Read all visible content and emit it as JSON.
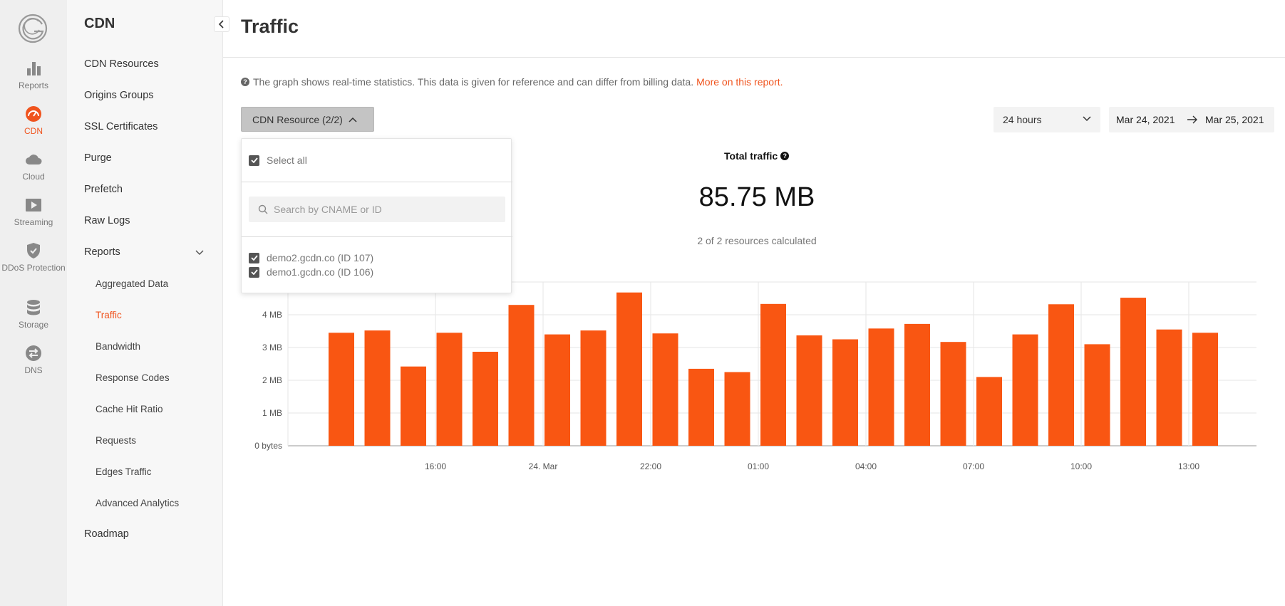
{
  "rail": {
    "items": [
      {
        "label": "Reports",
        "icon": "bar-chart-icon"
      },
      {
        "label": "CDN",
        "icon": "speedometer-icon",
        "active": true
      },
      {
        "label": "Cloud",
        "icon": "cloud-icon"
      },
      {
        "label": "Streaming",
        "icon": "play-icon"
      },
      {
        "label": "DDoS Protection",
        "icon": "shield-check-icon"
      },
      {
        "label": "Storage",
        "icon": "database-icon"
      },
      {
        "label": "DNS",
        "icon": "swap-icon"
      }
    ]
  },
  "nav": {
    "title": "CDN",
    "items": [
      {
        "label": "CDN Resources"
      },
      {
        "label": "Origins Groups"
      },
      {
        "label": "SSL Certificates"
      },
      {
        "label": "Purge"
      },
      {
        "label": "Prefetch"
      },
      {
        "label": "Raw Logs"
      },
      {
        "label": "Reports"
      }
    ],
    "reports_sub": [
      {
        "label": "Aggregated Data"
      },
      {
        "label": "Traffic",
        "active": true
      },
      {
        "label": "Bandwidth"
      },
      {
        "label": "Response Codes"
      },
      {
        "label": "Cache Hit Ratio"
      },
      {
        "label": "Requests"
      },
      {
        "label": "Edges Traffic"
      },
      {
        "label": "Advanced Analytics"
      }
    ],
    "roadmap": "Roadmap"
  },
  "main": {
    "title": "Traffic",
    "info_text": "The graph shows real-time statistics. This data is given for reference and can differ from billing data.",
    "info_link": "More on this report.",
    "resource_button": "CDN Resource (2/2)",
    "period": "24 hours",
    "date_from": "Mar 24, 2021",
    "date_to": "Mar 25, 2021",
    "total_label": "Total traffic",
    "total_value": "85.75 MB",
    "calculated": "2 of 2 resources calculated"
  },
  "dropdown": {
    "select_all": "Select all",
    "search_placeholder": "Search by CNAME or ID",
    "resources": [
      {
        "label": "demo2.gcdn.co (ID 107)",
        "checked": true
      },
      {
        "label": "demo1.gcdn.co (ID 106)",
        "checked": true
      }
    ]
  },
  "colors": {
    "accent": "#f0541e",
    "bar": "#f95612"
  },
  "chart_data": {
    "type": "bar",
    "y_unit": "MB",
    "ytick_labels": [
      "0 bytes",
      "1 MB",
      "2 MB",
      "3 MB",
      "4 MB"
    ],
    "ylim": [
      0,
      5
    ],
    "xtick_labels": [
      "16:00",
      "24. Mar",
      "22:00",
      "01:00",
      "04:00",
      "07:00",
      "10:00",
      "13:00"
    ],
    "grid": true,
    "values": [
      3.45,
      3.52,
      2.42,
      3.45,
      2.87,
      4.3,
      3.4,
      3.52,
      4.68,
      3.43,
      2.35,
      2.25,
      4.33,
      3.37,
      3.25,
      3.58,
      3.72,
      3.17,
      2.1,
      3.4,
      4.32,
      3.1,
      4.52,
      3.55,
      3.45
    ]
  }
}
